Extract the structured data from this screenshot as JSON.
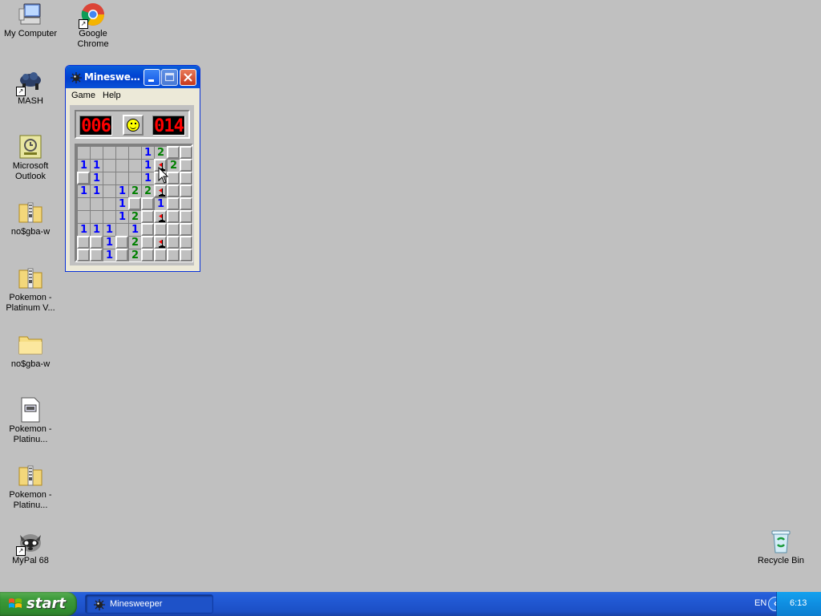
{
  "desktop": {
    "icons": [
      {
        "label": "My Computer",
        "icon": "computer-icon"
      },
      {
        "label": "Google Chrome",
        "icon": "chrome-icon"
      },
      {
        "label": "MASH",
        "icon": "mash-icon"
      },
      {
        "label": "Microsoft Outlook",
        "icon": "outlook-icon"
      },
      {
        "label": "no$gba-w",
        "icon": "zip-folder-icon"
      },
      {
        "label": "Pokemon - Platinum V...",
        "icon": "zip-folder-icon"
      },
      {
        "label": "no$gba-w",
        "icon": "folder-icon"
      },
      {
        "label": "Pokemon - Platinu...",
        "icon": "document-icon"
      },
      {
        "label": "Pokemon - Platinu...",
        "icon": "zip-folder-icon"
      },
      {
        "label": "MyPal 68",
        "icon": "mypal-icon"
      },
      {
        "label": "Recycle Bin",
        "icon": "recycle-bin-icon"
      }
    ]
  },
  "minesweeper": {
    "title": "Minesweeper",
    "title_display": "Mineswe…",
    "menu": [
      "Game",
      "Help"
    ],
    "mine_counter": "006",
    "timer": "014",
    "face": "smiley",
    "grid_rows": [
      "HHHHH12HH",
      "11HHH1F2H",
      "H1HHH1HHH",
      "11H122FHH",
      "HHH1HH1HH",
      "HHH12HFHH",
      "111H1HHHH",
      "HH1H2HFHH",
      "HH1H2HHHH"
    ],
    "grid_legend": "digits = revealed count, H = hidden, F = flagged, blank = revealed empty",
    "open_blank_cells": [
      [
        0,
        0
      ],
      [
        0,
        1
      ],
      [
        0,
        2
      ],
      [
        0,
        3
      ],
      [
        0,
        4
      ],
      [
        1,
        2
      ],
      [
        1,
        3
      ],
      [
        1,
        4
      ],
      [
        2,
        2
      ],
      [
        2,
        3
      ],
      [
        2,
        4
      ],
      [
        3,
        2
      ],
      [
        4,
        0
      ],
      [
        4,
        1
      ],
      [
        4,
        2
      ],
      [
        5,
        0
      ],
      [
        5,
        1
      ],
      [
        5,
        2
      ],
      [
        6,
        3
      ]
    ]
  },
  "taskbar": {
    "start_label": "start",
    "task_label": "Minesweeper",
    "language": "EN",
    "clock": "6:13"
  },
  "colors": {
    "desktop_bg": "#c0c0c0",
    "taskbar": "#245edb",
    "start_button": "#3c9a3a",
    "number_1": "#0000ff",
    "number_2": "#008000",
    "lcd_digits": "#ff0000"
  }
}
